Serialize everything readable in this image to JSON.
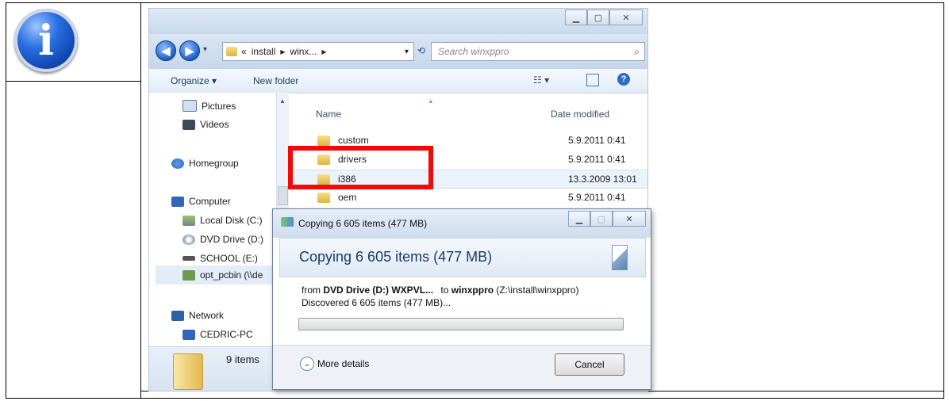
{
  "explorer": {
    "breadcrumb": [
      "«",
      "install",
      "▸",
      "winx...",
      "▸"
    ],
    "search_placeholder": "Search winxppro",
    "toolbar": {
      "organize": "Organize ▾",
      "new_folder": "New folder"
    },
    "nav": {
      "pictures": "Pictures",
      "videos": "Videos",
      "homegroup": "Homegroup",
      "computer": "Computer",
      "local_disk": "Local Disk (C:)",
      "dvd_drive": "DVD Drive (D:)",
      "school": "SCHOOL (E:)",
      "opt_pcbin": "opt_pcbin (\\\\de",
      "network": "Network",
      "cedric": "CEDRIC-PC"
    },
    "columns": {
      "name": "Name",
      "date": "Date modified"
    },
    "rows": [
      {
        "name": "custom",
        "date": "5.9.2011 0:41"
      },
      {
        "name": "drivers",
        "date": "5.9.2011 0:41"
      },
      {
        "name": "i386",
        "date": "13.3.2009 13:01"
      },
      {
        "name": "oem",
        "date": "5.9.2011 0:41"
      }
    ],
    "status": "9 items"
  },
  "dialog": {
    "title": "Copying 6 605 items (477 MB)",
    "heading": "Copying 6 605 items (477 MB)",
    "from_label": "from",
    "from_value": "DVD Drive (D:) WXPVL...",
    "to_label": "to",
    "to_value": "winxppro",
    "to_path": "(Z:\\install\\winxppro)",
    "discovered": "Discovered 6 605 items (477 MB)...",
    "progress_fraction": 0,
    "more_details": "More details",
    "cancel": "Cancel"
  }
}
